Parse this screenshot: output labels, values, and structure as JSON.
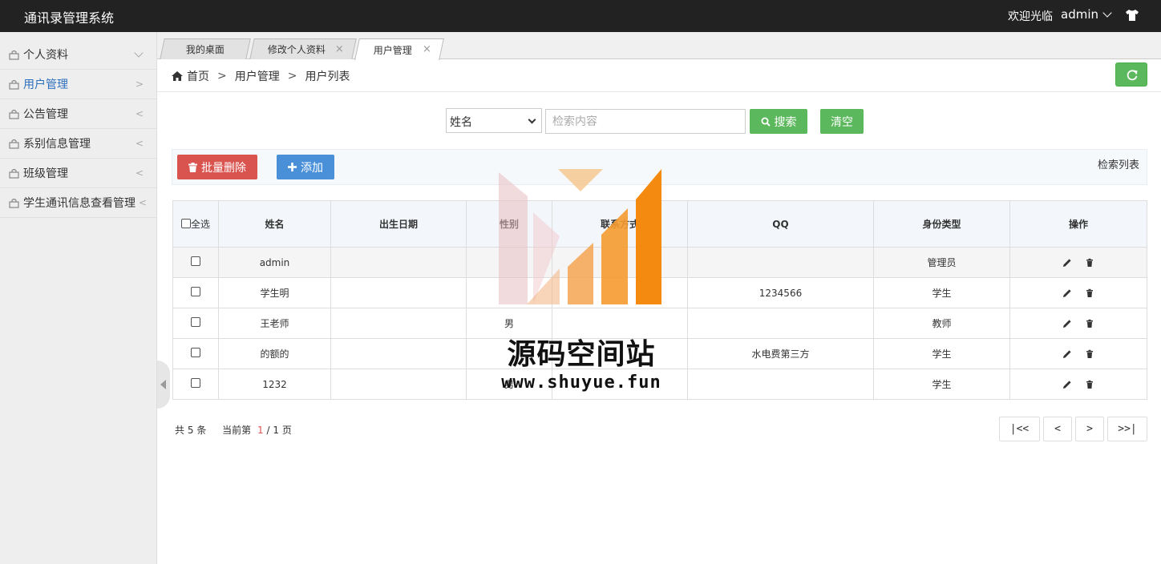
{
  "header": {
    "title": "通讯录管理系统",
    "welcome": "欢迎光临",
    "username": "admin"
  },
  "sidebar": {
    "items": [
      {
        "label": "个人资料",
        "arrow": "down"
      },
      {
        "label": "用户管理",
        "arrow": ">"
      },
      {
        "label": "公告管理",
        "arrow": "<"
      },
      {
        "label": "系别信息管理",
        "arrow": "<"
      },
      {
        "label": "班级管理",
        "arrow": "<"
      },
      {
        "label": "学生通讯信息查看管理",
        "arrow": "<"
      }
    ]
  },
  "tabs": [
    {
      "label": "我的桌面"
    },
    {
      "label": "修改个人资料"
    },
    {
      "label": "用户管理"
    }
  ],
  "breadcrumb": {
    "home": "首页",
    "level1": "用户管理",
    "level2": "用户列表",
    "sep": ">"
  },
  "search": {
    "field_selected": "姓名",
    "placeholder": "检索内容",
    "value": "",
    "search_label": "搜索",
    "clear_label": "清空"
  },
  "toolbar": {
    "batch_delete_label": "批量删除",
    "add_label": "添加",
    "list_title": "检索列表"
  },
  "table": {
    "select_all_label": "全选",
    "columns": [
      "姓名",
      "出生日期",
      "性别",
      "联系方式",
      "QQ",
      "身份类型",
      "操作"
    ],
    "rows": [
      {
        "name": "admin",
        "birth": "",
        "gender": "",
        "phone": "",
        "qq": "",
        "role": "管理员"
      },
      {
        "name": "学生明",
        "birth": "",
        "gender": "",
        "phone": "",
        "qq": "1234566",
        "role": "学生"
      },
      {
        "name": "王老师",
        "birth": "",
        "gender": "男",
        "phone": "",
        "qq": "",
        "role": "教师"
      },
      {
        "name": "的额的",
        "birth": "",
        "gender": "",
        "phone": "",
        "qq": "水电费第三方",
        "role": "学生"
      },
      {
        "name": "1232",
        "birth": "",
        "gender": "男",
        "phone": "",
        "qq": "",
        "role": "学生"
      }
    ]
  },
  "pagination": {
    "total_prefix": "共",
    "total": "5",
    "total_suffix": "条",
    "current_prefix": "当前第",
    "current": "1",
    "slash": "/",
    "pages": "1",
    "pages_suffix": "页",
    "first": "|<<",
    "prev": "<",
    "next": ">",
    "last": ">>|"
  },
  "watermark": {
    "text": "源码空间站",
    "url": "www.shuyue.fun"
  },
  "colors": {
    "header_bg": "#222222",
    "green": "#5cb85c",
    "red": "#d9534f",
    "blue": "#4a90d9",
    "active_link": "#2c6fbd"
  }
}
